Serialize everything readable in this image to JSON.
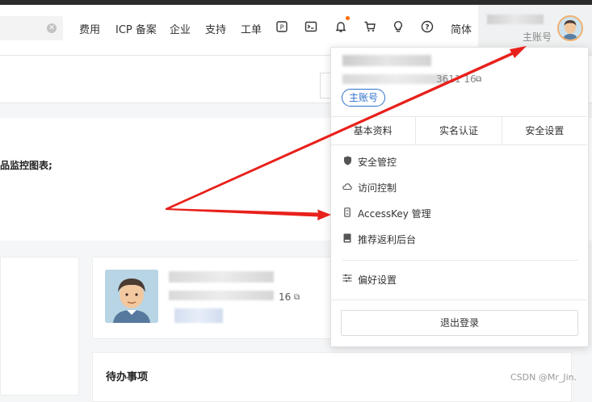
{
  "topnav": {
    "items": [
      {
        "label": "费用"
      },
      {
        "label": "ICP 备案"
      },
      {
        "label": "企业"
      },
      {
        "label": "支持"
      },
      {
        "label": "工单"
      }
    ],
    "language": "简体",
    "icons": [
      "app-store-icon",
      "terminal-icon",
      "bell-icon",
      "cart-icon",
      "lightbulb-icon",
      "help-icon"
    ]
  },
  "user": {
    "role": "主账号"
  },
  "dropdown": {
    "id_suffix": "3611 16",
    "role_pill": "主账号",
    "tabs": [
      "基本资料",
      "实名认证",
      "安全设置"
    ],
    "menu": [
      {
        "label": "安全管控",
        "icon": "shield-icon"
      },
      {
        "label": "访问控制",
        "icon": "cloud-icon"
      },
      {
        "label": "AccessKey 管理",
        "icon": "key-icon"
      },
      {
        "label": "推荐返利后台",
        "icon": "book-icon"
      }
    ],
    "preferences": {
      "label": "偏好设置",
      "icon": "sliders-icon"
    },
    "logout": "退出登录"
  },
  "page": {
    "notice": "品监控图表;",
    "profile_id_suffix": "16",
    "todo_title": "待办事项"
  },
  "annotation": {
    "arrow_color": "#e8201b"
  },
  "watermark": "CSDN @Mr_Jin."
}
